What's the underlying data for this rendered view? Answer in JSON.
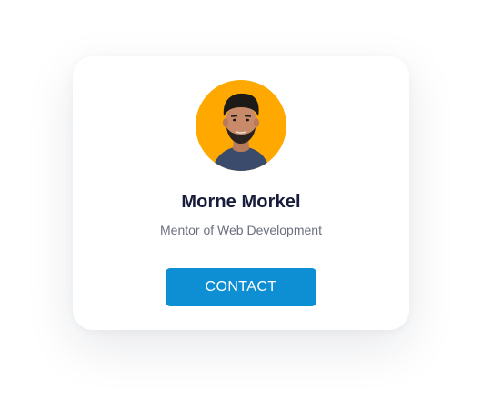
{
  "profile": {
    "name": "Morne Morkel",
    "role": "Mentor of Web Development",
    "contact_label": "CONTACT",
    "avatar_icon": "person-portrait-avatar"
  },
  "colors": {
    "avatar_background": "#ffa900",
    "button": "#0f8fd3",
    "name_text": "#171c3b",
    "role_text": "#6b6f80"
  }
}
